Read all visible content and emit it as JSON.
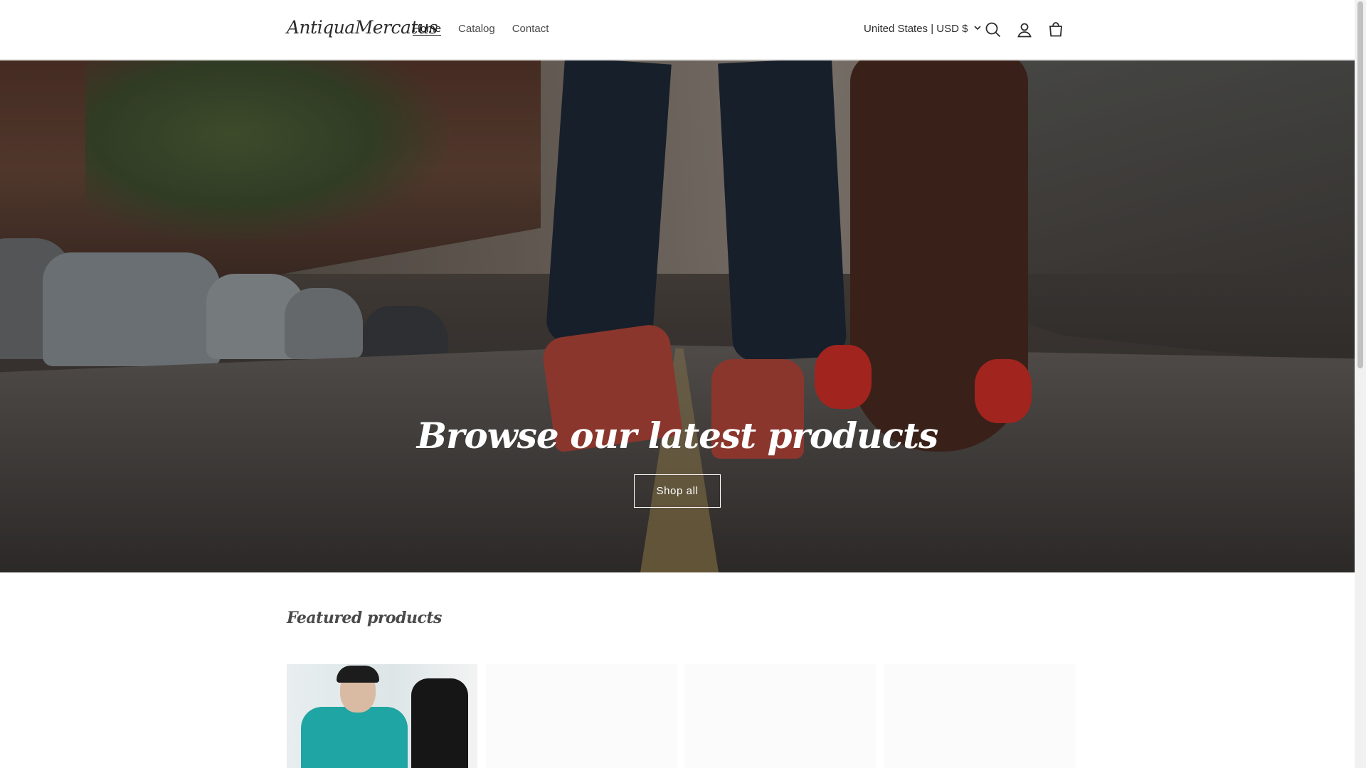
{
  "header": {
    "logo": "AntiquaMercatus",
    "nav": [
      {
        "label": "Home",
        "active": true
      },
      {
        "label": "Catalog",
        "active": false
      },
      {
        "label": "Contact",
        "active": false
      }
    ],
    "country_selector": "United States | USD $",
    "icons": [
      "search-icon",
      "account-icon",
      "cart-icon"
    ]
  },
  "hero": {
    "title": "Browse our latest products",
    "button": "Shop all"
  },
  "featured": {
    "title": "Featured products"
  },
  "colors": {
    "text": "#121212",
    "hero_text": "#ffffff",
    "accent_red": "#d8302a"
  }
}
